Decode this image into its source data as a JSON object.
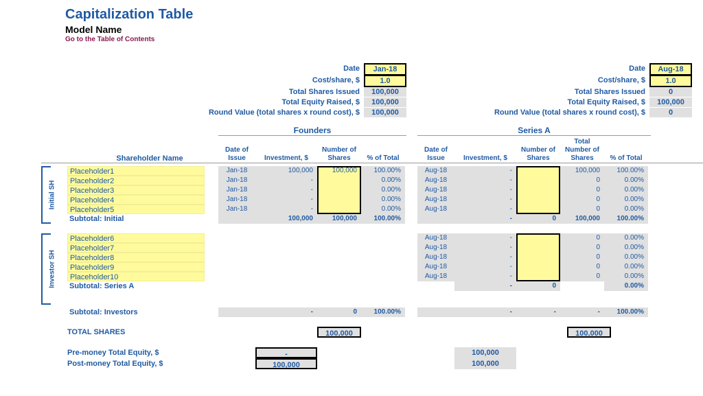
{
  "header": {
    "title": "Capitalization Table",
    "subtitle": "Model Name",
    "toc": "Go to the Table of Contents"
  },
  "summary_labels": {
    "date": "Date",
    "cost": "Cost/share, $",
    "shares": "Total Shares Issued",
    "equity": "Total Equity Raised, $",
    "round_value": "Round Value (total shares x round cost), $"
  },
  "founders": {
    "name": "Founders",
    "date": "Jan-18",
    "cost": "1.0",
    "shares": "100,000",
    "equity": "100,000",
    "round_value": "100,000"
  },
  "seriesA": {
    "name": "Series A",
    "date": "Aug-18",
    "cost": "1.0",
    "shares": "0",
    "equity": "100,000",
    "round_value": "0"
  },
  "cols": {
    "shareholder": "Shareholder Name",
    "date": "Date of Issue",
    "investment": "Investment, $",
    "shares": "Number of Shares",
    "total_shares": "Total Number of Shares",
    "pct": "% of Total"
  },
  "side": {
    "initial": "Initial SH",
    "investor": "Investor SH"
  },
  "initial": [
    {
      "name": "Placeholder1",
      "f_date": "Jan-18",
      "f_inv": "100,000",
      "f_sh": "100,000",
      "f_pct": "100.00%",
      "a_date": "Aug-18",
      "a_inv": "-",
      "a_sh": "",
      "a_tot": "100,000",
      "a_pct": "100.00%"
    },
    {
      "name": "Placeholder2",
      "f_date": "Jan-18",
      "f_inv": "-",
      "f_sh": "",
      "f_pct": "0.00%",
      "a_date": "Aug-18",
      "a_inv": "-",
      "a_sh": "",
      "a_tot": "0",
      "a_pct": "0.00%"
    },
    {
      "name": "Placeholder3",
      "f_date": "Jan-18",
      "f_inv": "-",
      "f_sh": "",
      "f_pct": "0.00%",
      "a_date": "Aug-18",
      "a_inv": "-",
      "a_sh": "",
      "a_tot": "0",
      "a_pct": "0.00%"
    },
    {
      "name": "Placeholder4",
      "f_date": "Jan-18",
      "f_inv": "-",
      "f_sh": "",
      "f_pct": "0.00%",
      "a_date": "Aug-18",
      "a_inv": "-",
      "a_sh": "",
      "a_tot": "0",
      "a_pct": "0.00%"
    },
    {
      "name": "Placeholder5",
      "f_date": "Jan-18",
      "f_inv": "-",
      "f_sh": "",
      "f_pct": "0.00%",
      "a_date": "Aug-18",
      "a_inv": "-",
      "a_sh": "",
      "a_tot": "0",
      "a_pct": "0.00%"
    }
  ],
  "initial_subtotal": {
    "label": "Subtotal: Initial",
    "f_inv": "100,000",
    "f_sh": "100,000",
    "f_pct": "100.00%",
    "a_inv": "-",
    "a_sh": "0",
    "a_tot": "100,000",
    "a_pct": "100.00%"
  },
  "investors": [
    {
      "name": "Placeholder6",
      "a_date": "Aug-18",
      "a_inv": "-",
      "a_sh": "",
      "a_tot": "0",
      "a_pct": "0.00%"
    },
    {
      "name": "Placeholder7",
      "a_date": "Aug-18",
      "a_inv": "-",
      "a_sh": "",
      "a_tot": "0",
      "a_pct": "0.00%"
    },
    {
      "name": "Placeholder8",
      "a_date": "Aug-18",
      "a_inv": "-",
      "a_sh": "",
      "a_tot": "0",
      "a_pct": "0.00%"
    },
    {
      "name": "Placeholder9",
      "a_date": "Aug-18",
      "a_inv": "-",
      "a_sh": "",
      "a_tot": "0",
      "a_pct": "0.00%"
    },
    {
      "name": "Placeholder10",
      "a_date": "Aug-18",
      "a_inv": "-",
      "a_sh": "",
      "a_tot": "0",
      "a_pct": "0.00%"
    }
  ],
  "seriesA_subtotal": {
    "label": "Subtotal: Series A",
    "a_inv": "-",
    "a_sh": "0",
    "a_tot": "",
    "a_pct": "0.00%"
  },
  "investors_subtotal": {
    "label": "Subtotal: Investors",
    "f_inv": "-",
    "f_sh": "0",
    "f_pct": "100.00%",
    "a_inv": "-",
    "a_sh": "-",
    "a_tot": "-",
    "a_pct": "100.00%"
  },
  "totals": {
    "total_shares_label": "TOTAL SHARES",
    "total_shares_f": "100,000",
    "total_shares_a": "100,000",
    "pre_label": "Pre-money Total Equity, $",
    "pre_f": "-",
    "pre_a": "100,000",
    "post_label": "Post-money Total Equity, $",
    "post_f": "100,000",
    "post_a": "100,000"
  }
}
